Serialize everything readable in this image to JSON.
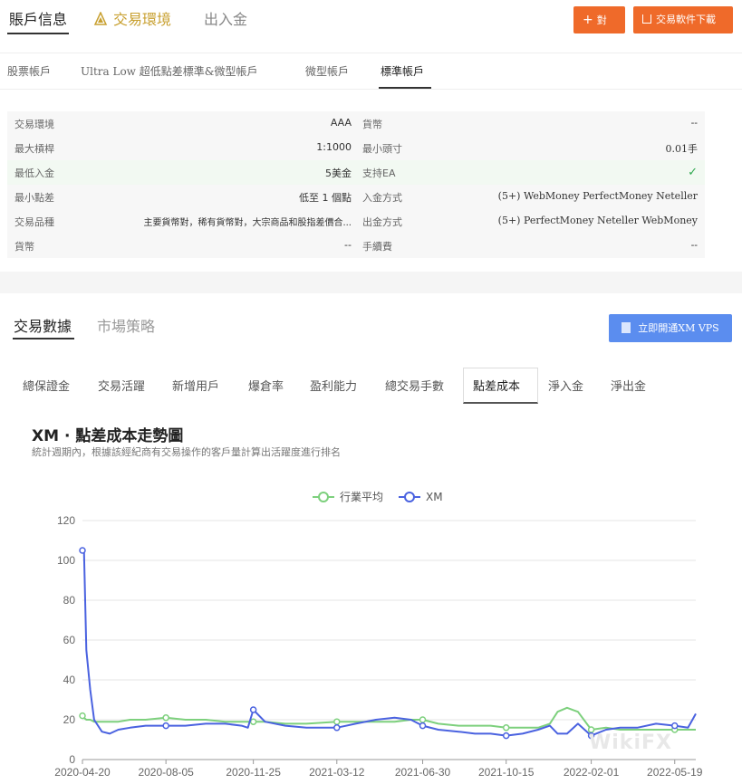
{
  "top_tabs": [
    "賬戶信息",
    "交易環境",
    "出入金"
  ],
  "buttons": {
    "compare": "對比",
    "download": "交易軟件下載"
  },
  "account_tabs": [
    "股票帳戶",
    "Ultra Low 超低點差標準&微型帳戶",
    "微型帳戶",
    "標準帳戶"
  ],
  "account_info": {
    "left": [
      {
        "label": "交易環境",
        "value": "AAA"
      },
      {
        "label": "最大槓桿",
        "value": "1:1000"
      },
      {
        "label": "最低入金",
        "value": "5美金"
      },
      {
        "label": "最小點差",
        "value": "低至 1 個點"
      },
      {
        "label": "交易品種",
        "value": "主要貨幣對，稀有貨幣對，大宗商品和股指差價合..."
      },
      {
        "label": "貨幣",
        "value": "--"
      }
    ],
    "right": [
      {
        "label": "貨幣",
        "value": "--"
      },
      {
        "label": "最小頭寸",
        "value": "0.01手"
      },
      {
        "label": "支持EA",
        "value": "✓"
      },
      {
        "label": "入金方式",
        "value": "(5+) WebMoney PerfectMoney Neteller"
      },
      {
        "label": "出金方式",
        "value": "(5+) PerfectMoney Neteller WebMoney"
      },
      {
        "label": "手續費",
        "value": "--"
      }
    ]
  },
  "data_tabs": [
    "交易數據",
    "市場策略"
  ],
  "vps_button": "立即開通XM VPS",
  "sub_tabs": [
    "總保證金",
    "交易活躍",
    "新增用戶",
    "爆倉率",
    "盈利能力",
    "總交易手數",
    "點差成本",
    "淨入金",
    "淨出金"
  ],
  "chart_title": "XM · 點差成本走勢圖",
  "chart_subtitle": "統計週期內，根據該經紀商有交易操作的客戶量計算出活躍度進行排名",
  "watermark": "WikiFX",
  "colors": {
    "accent": "#ef6a2a",
    "industry": "#7dd07d",
    "xm": "#4a62e0",
    "vps": "#5b8def"
  },
  "chart_data": {
    "type": "line",
    "x": [
      "2020-04-20",
      "2020-04-22",
      "2020-04-25",
      "2020-04-30",
      "2020-05-05",
      "2020-05-15",
      "2020-05-25",
      "2020-06-05",
      "2020-06-20",
      "2020-07-10",
      "2020-08-05",
      "2020-08-30",
      "2020-09-25",
      "2020-10-20",
      "2020-11-10",
      "2020-11-18",
      "2020-11-25",
      "2020-12-10",
      "2021-01-05",
      "2021-02-01",
      "2021-03-12",
      "2021-04-05",
      "2021-05-01",
      "2021-05-25",
      "2021-06-15",
      "2021-06-30",
      "2021-07-20",
      "2021-08-15",
      "2021-09-05",
      "2021-09-25",
      "2021-10-15",
      "2021-11-05",
      "2021-11-25",
      "2021-12-10",
      "2021-12-20",
      "2022-01-01",
      "2022-01-15",
      "2022-02-01",
      "2022-02-20",
      "2022-03-10",
      "2022-04-01",
      "2022-04-25",
      "2022-05-19",
      "2022-06-05",
      "2022-06-15"
    ],
    "series": [
      {
        "name": "行業平均",
        "values": [
          22,
          21,
          20,
          20,
          19,
          19,
          19,
          19,
          20,
          20,
          21,
          20,
          20,
          19,
          19,
          19,
          19,
          19,
          18,
          18,
          19,
          19,
          19,
          19,
          20,
          20,
          18,
          17,
          17,
          17,
          16,
          16,
          16,
          18,
          24,
          26,
          24,
          15,
          16,
          15,
          15,
          15,
          15,
          15,
          15
        ]
      },
      {
        "name": "XM",
        "values": [
          105,
          105,
          55,
          35,
          20,
          14,
          13,
          15,
          16,
          17,
          17,
          17,
          18,
          18,
          17,
          16,
          25,
          19,
          17,
          16,
          16,
          18,
          20,
          21,
          20,
          17,
          15,
          14,
          13,
          13,
          12,
          13,
          15,
          17,
          13,
          13,
          18,
          12,
          15,
          16,
          16,
          18,
          17,
          16,
          23
        ]
      }
    ],
    "x_ticks": [
      "2020-04-20",
      "2020-08-05",
      "2020-11-25",
      "2021-03-12",
      "2021-06-30",
      "2021-10-15",
      "2022-02-01",
      "2022-05-19"
    ],
    "ylim": [
      0,
      120
    ],
    "y_ticks": [
      0,
      20,
      40,
      60,
      80,
      100,
      120
    ],
    "grid": true,
    "legend_position": "top-center"
  }
}
